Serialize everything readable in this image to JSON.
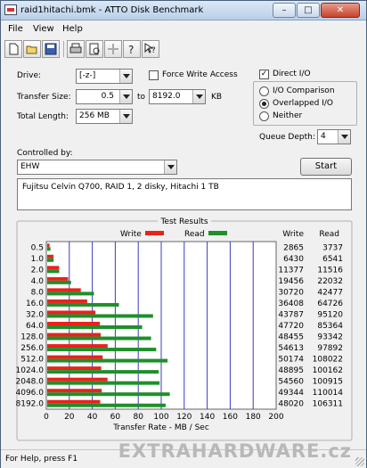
{
  "window": {
    "title": "raid1hitachi.bmk - ATTO Disk Benchmark",
    "minimize_glyph": "–",
    "maximize_glyph": "□",
    "close_glyph": "✕"
  },
  "menu": [
    "File",
    "View",
    "Help"
  ],
  "toolbar": [
    "new-icon",
    "open-icon",
    "save-icon",
    "print-icon",
    "print-preview-icon",
    "move-icon",
    "help-icon",
    "whats-this-icon"
  ],
  "settings": {
    "drive_label": "Drive:",
    "drive_value": "[-z-]",
    "force_write_label": "Force Write Access",
    "force_write_checked": false,
    "transfer_size_label": "Transfer Size:",
    "transfer_from": "0.5",
    "to_label": "to",
    "transfer_to": "8192.0",
    "kb_label": "KB",
    "total_length_label": "Total Length:",
    "total_length_value": "256 MB",
    "direct_io_label": "Direct I/O",
    "direct_io_checked": true,
    "io_comparison_label": "I/O Comparison",
    "overlapped_io_label": "Overlapped I/O",
    "neither_label": "Neither",
    "selected_mode": "Overlapped I/O",
    "queue_depth_label": "Queue Depth:",
    "queue_depth_value": "4",
    "controlled_by_label": "Controlled by:",
    "controlled_by_value": "EHW",
    "start_label": "Start",
    "description": "Fujitsu Celvin Q700, RAID 1, 2 disky, Hitachi 1 TB"
  },
  "results": {
    "group_label": "Test Results",
    "legend_write": "Write",
    "legend_read": "Read",
    "col_write": "Write",
    "col_read": "Read",
    "write_color": "#e8231b",
    "read_color": "#1f8f2a"
  },
  "chart_data": {
    "type": "bar",
    "orientation": "horizontal",
    "categories": [
      "0.5",
      "1.0",
      "2.0",
      "4.0",
      "8.0",
      "16.0",
      "32.0",
      "64.0",
      "128.0",
      "256.0",
      "512.0",
      "1024.0",
      "2048.0",
      "4096.0",
      "8192.0"
    ],
    "series": [
      {
        "name": "Write",
        "values": [
          2865,
          6430,
          11377,
          19456,
          30720,
          36408,
          43787,
          47720,
          48455,
          54613,
          50174,
          48895,
          54560,
          49344,
          48020
        ]
      },
      {
        "name": "Read",
        "values": [
          3737,
          6541,
          11516,
          22032,
          42477,
          64726,
          95120,
          85364,
          93342,
          97892,
          108022,
          100162,
          100915,
          110014,
          106311
        ]
      }
    ],
    "xlabel": "Transfer Rate - MB / Sec",
    "xticks": [
      "0",
      "20",
      "40",
      "60",
      "80",
      "100",
      "120",
      "140",
      "160",
      "180",
      "200"
    ],
    "xlim": [
      0,
      200
    ],
    "grid": true,
    "legend": "top"
  },
  "status": {
    "text": "For Help, press F1",
    "watermark": "EXTRAHARDWARE.cz"
  }
}
